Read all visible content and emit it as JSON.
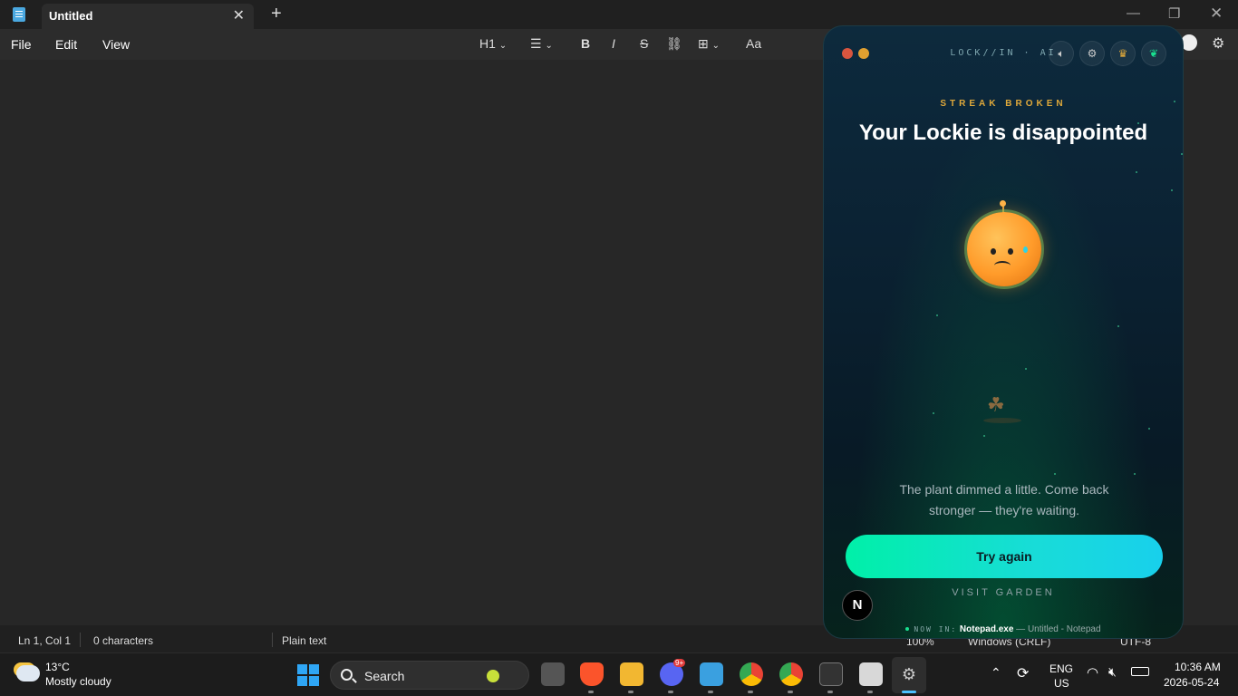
{
  "titlebar": {
    "tab_title": "Untitled",
    "close_glyph": "✕",
    "new_tab_glyph": "+",
    "minimize_glyph": "—",
    "restore_glyph": "❐",
    "close_window_glyph": "✕"
  },
  "menu": {
    "file": "File",
    "edit": "Edit",
    "view": "View"
  },
  "toolbar": {
    "heading": "H1",
    "list_icon": "list-icon",
    "bold": "B",
    "italic": "I",
    "strike": "S",
    "link_icon": "link-icon",
    "table_icon": "table-icon",
    "spellcheck_icon": "spellcheck-icon"
  },
  "status": {
    "position": "Ln 1, Col 1",
    "chars": "0 characters",
    "format": "Plain text",
    "zoom": "100%",
    "line_endings": "Windows (CRLF)",
    "encoding": "UTF-8"
  },
  "widget": {
    "brand": "LOCK//IN · AI",
    "kicker": "STREAK BROKEN",
    "headline": "Your Lockie is disappointed",
    "message": "The plant dimmed a little. Come back stronger — they're waiting.",
    "cta": "Try again",
    "garden_link": "VISIT GARDEN",
    "badge": "N",
    "now_in_label": "NOW IN:",
    "now_in_app": "Notepad.exe",
    "now_in_window": "— Untitled - Notepad",
    "icons": {
      "sound": "speaker-icon",
      "settings": "gear-icon",
      "trophy": "trophy-icon",
      "garden": "leaf-icon"
    },
    "colors": {
      "accent": "#00f0a8",
      "kicker": "#e0a93a",
      "mascot": "#ff9b2a"
    }
  },
  "taskbar": {
    "weather_temp": "13°C",
    "weather_desc": "Mostly cloudy",
    "search_placeholder": "Search",
    "discord_badge": "9+",
    "lang_top": "ENG",
    "lang_bottom": "US",
    "time": "10:36 AM",
    "date": "2026-05-24"
  }
}
